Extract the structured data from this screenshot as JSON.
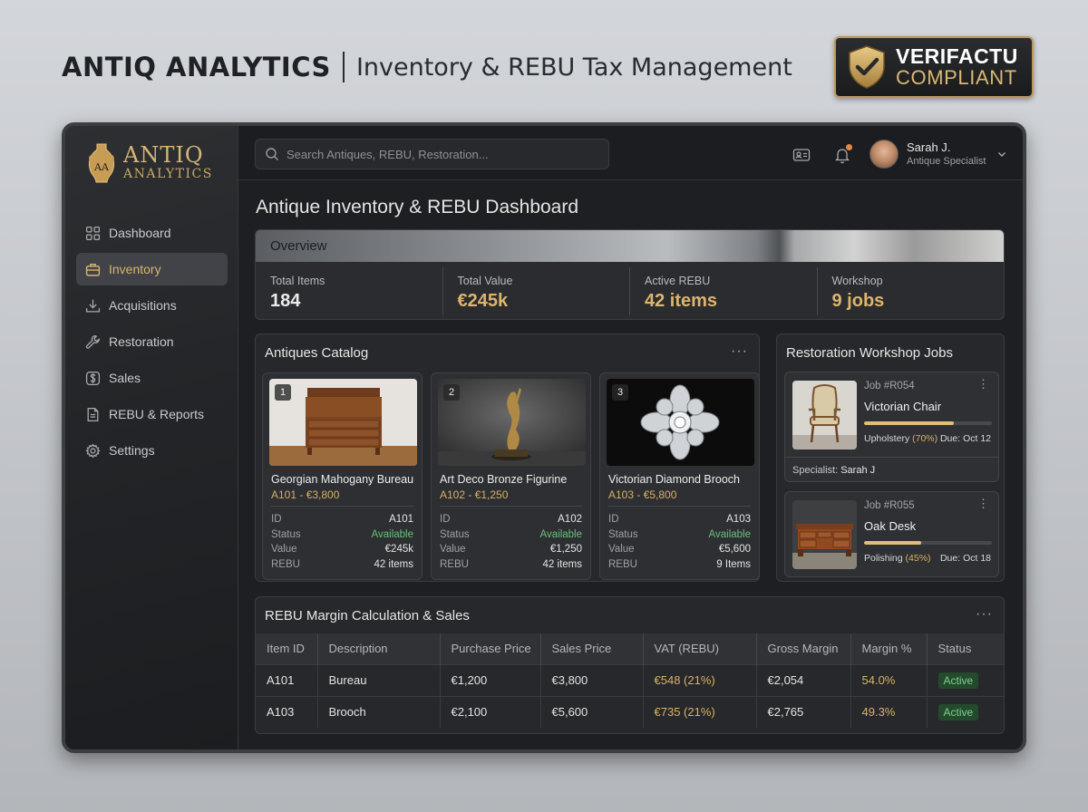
{
  "banner": {
    "brand": "ANTIQ ANALYTICS",
    "tagline": "Inventory & REBU Tax Management",
    "badge_line1": "VERIFACTU",
    "badge_line2": "COMPLIANT"
  },
  "logo": {
    "line1": "ANTIQ",
    "line2": "ANALYTICS"
  },
  "sidebar": {
    "items": [
      {
        "label": "Dashboard",
        "icon": "grid-icon",
        "active": false
      },
      {
        "label": "Inventory",
        "icon": "briefcase-icon",
        "active": true
      },
      {
        "label": "Acquisitions",
        "icon": "download-icon",
        "active": false
      },
      {
        "label": "Restoration",
        "icon": "wrench-icon",
        "active": false
      },
      {
        "label": "Sales",
        "icon": "dollar-icon",
        "active": false
      },
      {
        "label": "REBU & Reports",
        "icon": "document-icon",
        "active": false
      },
      {
        "label": "Settings",
        "icon": "gear-icon",
        "active": false
      }
    ]
  },
  "topbar": {
    "search_placeholder": "Search Antiques, REBU, Restoration...",
    "user_name": "Sarah J.",
    "user_role": "Antique Specialist"
  },
  "main": {
    "title": "Antique Inventory & REBU Dashboard"
  },
  "overview": {
    "title": "Overview",
    "stats": [
      {
        "label": "Total Items",
        "value": "184"
      },
      {
        "label": "Total Value",
        "value": "€245k"
      },
      {
        "label": "Active REBU",
        "value": "42 items"
      },
      {
        "label": "Workshop",
        "value": "9 jobs"
      }
    ]
  },
  "catalog": {
    "title": "Antiques Catalog",
    "more": "···",
    "cards": [
      {
        "num": "1",
        "title": "Georgian Mahogany Bureau",
        "subtitle": "A101 - €3,800",
        "rows": [
          {
            "k": "ID",
            "v": "A101"
          },
          {
            "k": "Status",
            "v": "Available"
          },
          {
            "k": "Value",
            "v": "€245k"
          },
          {
            "k": "REBU",
            "v": "42 items"
          }
        ]
      },
      {
        "num": "2",
        "title": "Art Deco Bronze Figurine",
        "subtitle": "A102 - €1,250",
        "rows": [
          {
            "k": "ID",
            "v": "A102"
          },
          {
            "k": "Status",
            "v": "Available"
          },
          {
            "k": "Value",
            "v": "€1,250"
          },
          {
            "k": "REBU",
            "v": "42 items"
          }
        ]
      },
      {
        "num": "3",
        "title": "Victorian Diamond Brooch",
        "subtitle": "A103 - €5,800",
        "rows": [
          {
            "k": "ID",
            "v": "A103"
          },
          {
            "k": "Status",
            "v": "Available"
          },
          {
            "k": "Value",
            "v": "€5,600"
          },
          {
            "k": "REBU",
            "v": "9 Items"
          }
        ]
      }
    ]
  },
  "workshop": {
    "title": "Restoration Workshop Jobs",
    "jobs": [
      {
        "id": "Job #R054",
        "name": "Victorian Chair",
        "phase": "Upholstery",
        "pct": "(70%)",
        "progress": 0.7,
        "due": "Due: Oct 12",
        "specialist_label": "Specialist:",
        "specialist": "Sarah J"
      },
      {
        "id": "Job #R055",
        "name": "Oak Desk",
        "phase": "Polishing",
        "pct": "(45%)",
        "progress": 0.45,
        "due": "Due: Oct 18"
      }
    ]
  },
  "rebu": {
    "title": "REBU Margin Calculation & Sales",
    "more": "···",
    "columns": [
      "Item ID",
      "Description",
      "Purchase Price",
      "Sales Price",
      "VAT (REBU)",
      "Gross Margin",
      "Margin %",
      "Status"
    ],
    "rows": [
      [
        "A101",
        "Bureau",
        "€1,200",
        "€3,800",
        "€548 (21%)",
        "€2,054",
        "54.0%",
        "Active"
      ],
      [
        "A103",
        "Brooch",
        "€2,100",
        "€5,600",
        "€735 (21%)",
        "€2,765",
        "49.3%",
        "Active"
      ]
    ]
  },
  "colors": {
    "accent_gold": "#d7b675",
    "status_green": "#68c178",
    "background": "#1e1f22"
  }
}
